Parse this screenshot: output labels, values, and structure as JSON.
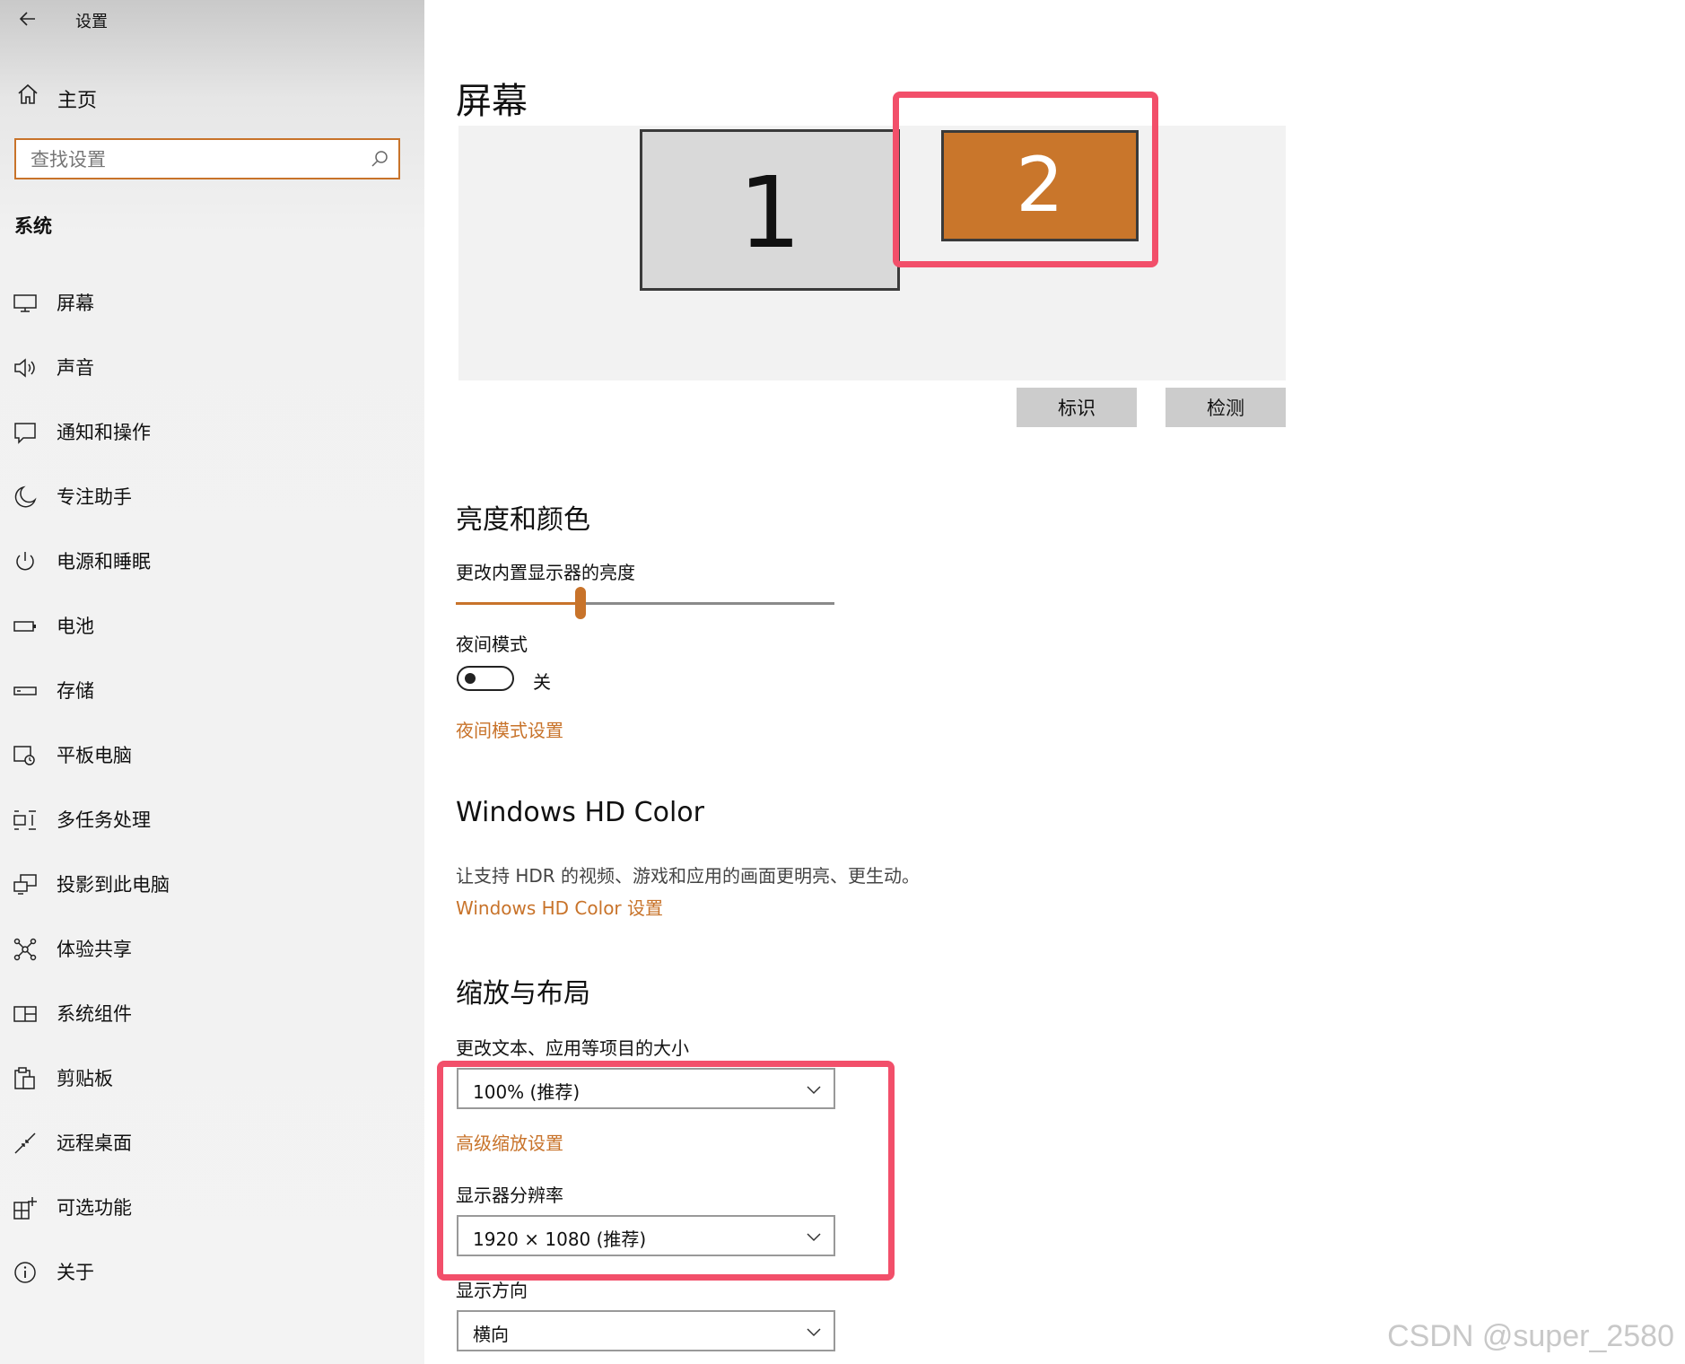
{
  "window": {
    "title": "设置"
  },
  "sidebar": {
    "home_label": "主页",
    "search_placeholder": "查找设置",
    "section": "系统",
    "items": [
      {
        "label": "屏幕",
        "icon": "monitor-icon"
      },
      {
        "label": "声音",
        "icon": "speaker-icon"
      },
      {
        "label": "通知和操作",
        "icon": "notification-icon"
      },
      {
        "label": "专注助手",
        "icon": "moon-icon"
      },
      {
        "label": "电源和睡眠",
        "icon": "power-icon"
      },
      {
        "label": "电池",
        "icon": "battery-icon"
      },
      {
        "label": "存储",
        "icon": "storage-icon"
      },
      {
        "label": "平板电脑",
        "icon": "tablet-icon"
      },
      {
        "label": "多任务处理",
        "icon": "multitask-icon"
      },
      {
        "label": "投影到此电脑",
        "icon": "project-icon"
      },
      {
        "label": "体验共享",
        "icon": "share-icon"
      },
      {
        "label": "系统组件",
        "icon": "components-icon"
      },
      {
        "label": "剪贴板",
        "icon": "clipboard-icon"
      },
      {
        "label": "远程桌面",
        "icon": "remote-desktop-icon"
      },
      {
        "label": "可选功能",
        "icon": "optional-features-icon"
      },
      {
        "label": "关于",
        "icon": "info-icon"
      }
    ]
  },
  "main": {
    "title": "屏幕",
    "monitors": [
      {
        "number": "1"
      },
      {
        "number": "2"
      }
    ],
    "identify_label": "标识",
    "detect_label": "检测",
    "brightness": {
      "heading": "亮度和颜色",
      "slider_label": "更改内置显示器的亮度",
      "value_pct": 33
    },
    "night_light": {
      "label": "夜间模式",
      "state": "关",
      "settings_link": "夜间模式设置"
    },
    "hdr": {
      "heading": "Windows HD Color",
      "desc": "让支持 HDR 的视频、游戏和应用的画面更明亮、更生动。",
      "link": "Windows HD Color 设置"
    },
    "scale": {
      "heading": "缩放与布局",
      "size_label": "更改文本、应用等项目的大小",
      "size_value": "100% (推荐)",
      "advanced_link": "高级缩放设置",
      "resolution_label": "显示器分辨率",
      "resolution_value": "1920 × 1080 (推荐)",
      "orientation_label": "显示方向",
      "orientation_value": "横向"
    }
  },
  "watermark": "CSDN @super_2580",
  "colors": {
    "accent": "#c8732a",
    "annotation": "#f24f6a",
    "monitor_selected": "#c9762b"
  }
}
